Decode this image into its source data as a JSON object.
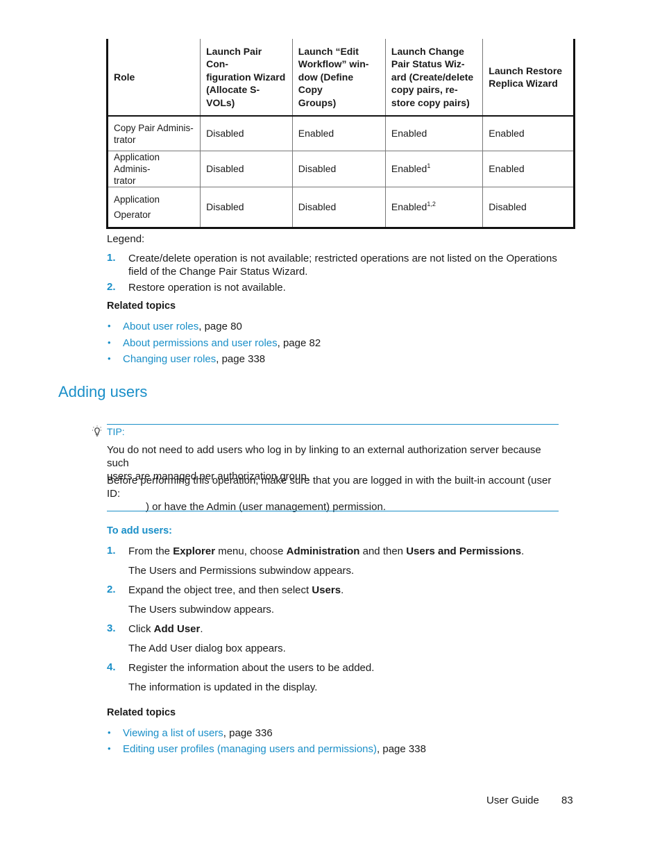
{
  "table": {
    "headers": [
      "Role",
      "Launch Pair Con-figuration Wizard (Allocate S-VOLs)",
      "Launch “Edit Workflow” win-dow (Define Copy Groups)",
      "Launch Change Pair Status Wiz-ard (Create/delete copy pairs, re-store copy pairs)",
      "Launch Restore Replica Wizard"
    ],
    "header_lines": [
      [
        "Role"
      ],
      [
        "Launch Pair Con-",
        "figuration Wizard",
        "(Allocate S-VOLs)"
      ],
      [
        "Launch “Edit",
        "Workflow” win-",
        "dow (Define Copy",
        "Groups)"
      ],
      [
        "Launch Change",
        "Pair Status Wiz-",
        "ard (Create/delete",
        "copy pairs, re-",
        "store copy pairs)"
      ],
      [
        "Launch Restore",
        "Replica Wizard"
      ]
    ],
    "rows": [
      {
        "role_lines": [
          "Copy Pair Adminis-",
          "trator"
        ],
        "cells": [
          "Disabled",
          "Enabled",
          "Enabled",
          "Enabled"
        ],
        "sups": [
          "",
          "",
          "",
          ""
        ]
      },
      {
        "role_lines": [
          "Application Adminis-",
          "trator"
        ],
        "cells": [
          "Disabled",
          "Disabled",
          "Enabled",
          "Enabled"
        ],
        "sups": [
          "",
          "",
          "1",
          ""
        ]
      },
      {
        "role_lines": [
          "Application",
          "Operator"
        ],
        "cells": [
          "Disabled",
          "Disabled",
          "Enabled",
          "Disabled"
        ],
        "sups": [
          "",
          "",
          "1,2",
          ""
        ]
      }
    ]
  },
  "legend": {
    "label": "Legend:",
    "items": [
      {
        "num": "1.",
        "lines": [
          "Create/delete operation is not available; restricted operations are not listed on the Operations",
          "field of the Change Pair Status Wizard."
        ]
      },
      {
        "num": "2.",
        "lines": [
          "Restore operation is not available."
        ]
      }
    ]
  },
  "related1": {
    "heading": "Related topics",
    "items": [
      {
        "link": "About user roles",
        "suffix": ", page 80"
      },
      {
        "link": "About permissions and user roles",
        "suffix": ", page 82"
      },
      {
        "link": "Changing user roles",
        "suffix": ", page 338"
      }
    ]
  },
  "section": {
    "title": "Adding users"
  },
  "tip": {
    "icon": "lightbulb-icon",
    "label": "TIP:",
    "para1": [
      "You do not need to add users who log in by linking to an external authorization server because such",
      "users are managed per authorization group."
    ],
    "para2": [
      "Before performing this operation, make sure that you are logged in with the built-in account (user ID:",
      ") or have the Admin (user management) permission."
    ]
  },
  "procedure": {
    "heading": "To add users:",
    "steps": [
      {
        "num": "1.",
        "parts": [
          [
            "From the ",
            false
          ],
          [
            "Explorer",
            true
          ],
          [
            " menu, choose ",
            false
          ],
          [
            "Administration",
            true
          ],
          [
            " and then ",
            false
          ],
          [
            "Users and Permissions",
            true
          ],
          [
            ".",
            false
          ]
        ],
        "result": "The Users and Permissions subwindow appears."
      },
      {
        "num": "2.",
        "parts": [
          [
            "Expand the object tree, and then select ",
            false
          ],
          [
            "Users",
            true
          ],
          [
            ".",
            false
          ]
        ],
        "result": "The Users subwindow appears."
      },
      {
        "num": "3.",
        "parts": [
          [
            "Click ",
            false
          ],
          [
            "Add User",
            true
          ],
          [
            ".",
            false
          ]
        ],
        "result": "The Add User dialog box appears."
      },
      {
        "num": "4.",
        "parts": [
          [
            "Register the information about the users to be added.",
            false
          ]
        ],
        "result": "The information is updated in the display."
      }
    ]
  },
  "related2": {
    "heading": "Related topics",
    "items": [
      {
        "link": "Viewing a list of users",
        "suffix": ", page 336"
      },
      {
        "link": "Editing user profiles (managing users and permissions)",
        "suffix": ", page 338"
      }
    ]
  },
  "footer": {
    "title": "User Guide",
    "page": "83"
  },
  "colors": {
    "accent": "#1a8fc8",
    "text": "#1a1a1a"
  }
}
